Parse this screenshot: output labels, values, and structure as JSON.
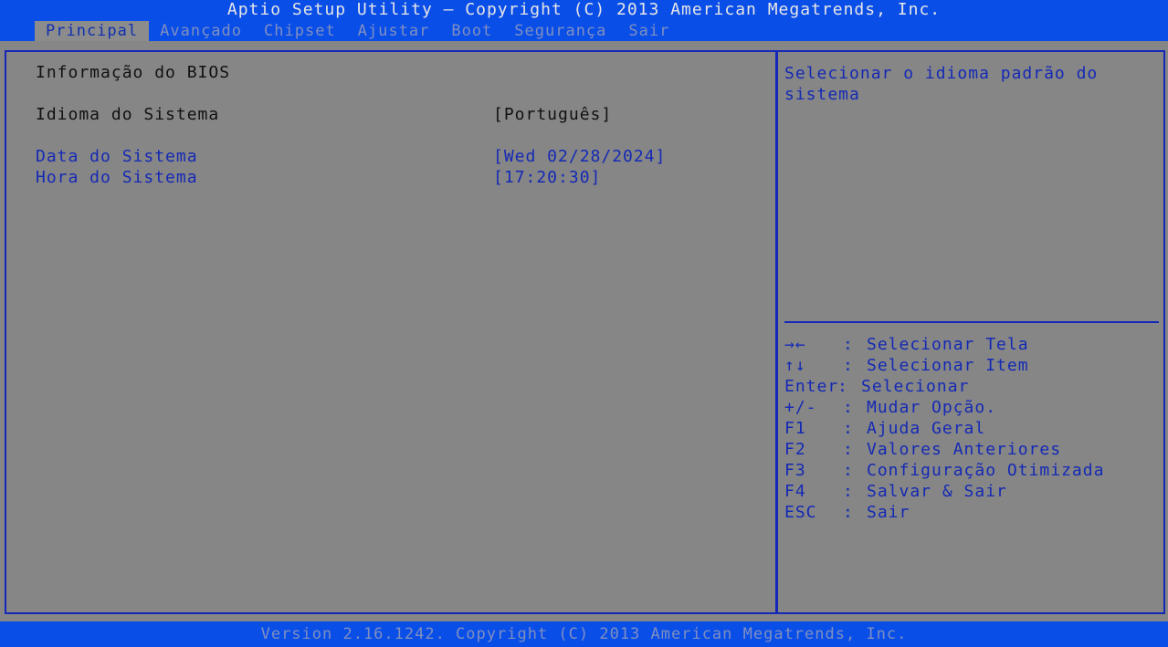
{
  "header": {
    "title": "Aptio Setup Utility – Copyright (C) 2013 American Megatrends, Inc."
  },
  "tabs": [
    {
      "label": "Principal",
      "active": true
    },
    {
      "label": "Avançado",
      "active": false
    },
    {
      "label": "Chipset",
      "active": false
    },
    {
      "label": "Ajustar",
      "active": false
    },
    {
      "label": "Boot",
      "active": false
    },
    {
      "label": "Segurança",
      "active": false
    },
    {
      "label": "Sair",
      "active": false
    }
  ],
  "main": {
    "section_title": "Informação do BIOS",
    "language": {
      "label": "Idioma do Sistema",
      "value": "[Português]"
    },
    "date": {
      "label": "Data do Sistema",
      "value": "[Wed 02/28/2024]"
    },
    "time": {
      "label": "Hora do Sistema",
      "value": "[17:20:30]"
    }
  },
  "help": {
    "text": "Selecionar o idioma padrão do sistema",
    "keys": [
      {
        "key": "→←",
        "action": "Selecionar Tela"
      },
      {
        "key": "↑↓",
        "action": "Selecionar Item"
      },
      {
        "key": "Enter",
        "action": "Selecionar"
      },
      {
        "key": "+/-",
        "action": "Mudar Opção."
      },
      {
        "key": "F1",
        "action": "Ajuda Geral"
      },
      {
        "key": "F2",
        "action": "Valores Anteriores"
      },
      {
        "key": "F3",
        "action": "Configuração Otimizada"
      },
      {
        "key": "F4",
        "action": "Salvar & Sair"
      },
      {
        "key": "ESC",
        "action": "Sair"
      }
    ]
  },
  "footer": {
    "text": "Version 2.16.1242. Copyright (C) 2013 American Megatrends, Inc."
  },
  "colors": {
    "background_blue": "#0a4ee8",
    "panel_gray": "#868686",
    "text_blue": "#1429b5",
    "text_dark": "#111111",
    "inactive_tab": "#7f8fc0"
  }
}
